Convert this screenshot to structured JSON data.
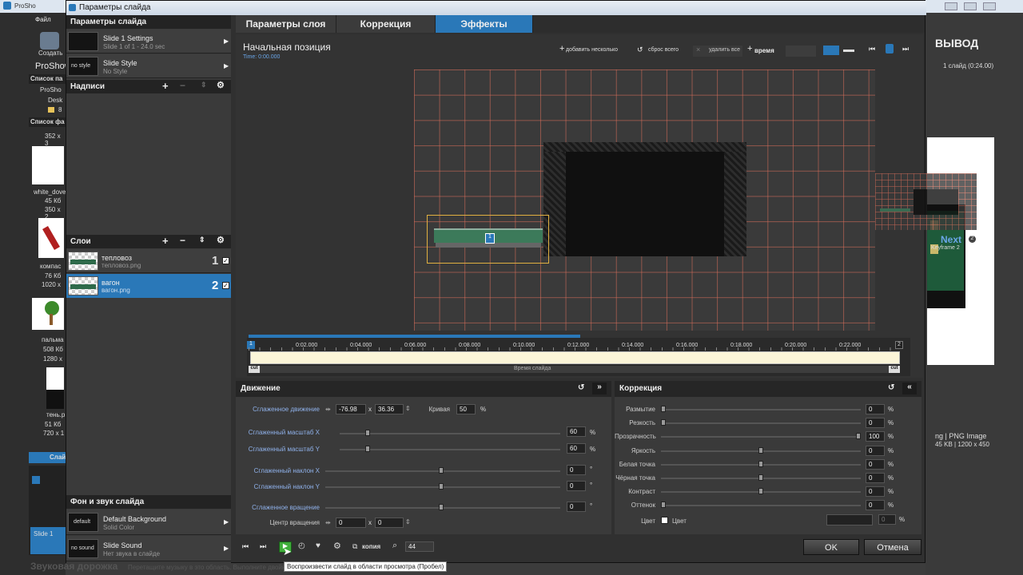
{
  "main_app": {
    "app_tab": "ProSho",
    "menu_file": "Файл",
    "create_label": "Создать",
    "proshow_label": "ProShow",
    "slides_list_header": "Список па",
    "tree_item": "ProSho",
    "tree_item2": "Desk",
    "tree_item3": "8",
    "files_list_header": "Список фа",
    "top_dim": "352 x 3",
    "files": [
      {
        "name": "white_dove",
        "size": "45 Кб",
        "dims": "350 x 2"
      },
      {
        "name": "компас",
        "size": "76 Кб",
        "dims": "1020 x"
      },
      {
        "name": "пальма",
        "size": "508 Кб",
        "dims": "1280 x"
      },
      {
        "name": "тень.р",
        "size": "51 Кб",
        "dims": "720 x 1"
      }
    ],
    "slides_tab": "Слай",
    "slide1_label": "Slide 1",
    "audio_track": "Звуковая дорожка",
    "audio_hint": "Перетащите музыку в это область. Выполните двойной",
    "output_label": "ВЫВОД",
    "output_info": "1 слайд (0:24.00)",
    "right_file_info": "ng | PNG Image",
    "right_file_info2": "45 KB | 1200 x 450"
  },
  "dialog": {
    "title": "Параметры слайда",
    "left": {
      "header": "Параметры слайда",
      "slide_settings_title": "Slide 1 Settings",
      "slide_settings_sub": "Slide 1 of 1 - 24.0 sec",
      "style_thumb": "no style",
      "style_title": "Slide Style",
      "style_sub": "No Style",
      "captions_header": "Надписи",
      "layers_header": "Слои",
      "layers": [
        {
          "name": "тепловоз",
          "file": "тепловоз.png",
          "num": "1"
        },
        {
          "name": "вагон",
          "file": "вагон.png",
          "num": "2"
        }
      ],
      "bg_header": "Фон и звук слайда",
      "bg_thumb": "default",
      "bg_title": "Default Background",
      "bg_sub": "Solid Color",
      "sound_thumb": "no sound",
      "sound_title": "Slide Sound",
      "sound_sub": "Нет звука в слайде"
    },
    "tabs": [
      "Параметры слоя",
      "Коррекция",
      "Эффекты"
    ],
    "preview": {
      "title": "Начальная позиция",
      "time": "Time: 0:00.000",
      "toolbar": {
        "add_several": "добавить несколько",
        "reset_all": "сброс всего",
        "delete_all": "удалить все",
        "time": "время"
      },
      "next_label": "Next",
      "next_num": "2",
      "keyframe_label": "Keyframe 2",
      "marker1": "1"
    },
    "timeline": {
      "ticks": [
        "0:02.000",
        "0:04.000",
        "0:06.000",
        "0:08.000",
        "0:10.000",
        "0:12.000",
        "0:14.000",
        "0:16.000",
        "0:18.000",
        "0:20.000",
        "0:22.000"
      ],
      "start_marker": "1",
      "end_marker": "2",
      "cut_left": "cut",
      "cut_right": "cut",
      "slide_time": "Время слайда"
    },
    "motion": {
      "header": "Движение",
      "rows": {
        "smooth_move": "Сглаженное движение",
        "x_val": "-76.98",
        "x_sep": "x",
        "y_val": "36.36",
        "curve_label": "Кривая",
        "curve_val": "50",
        "curve_unit": "%",
        "scale_x": "Сглаженный масштаб X",
        "scale_x_val": "60",
        "scale_y": "Сглаженный масштаб Y",
        "scale_y_val": "60",
        "tilt_x": "Сглаженный наклон X",
        "tilt_x_val": "0",
        "tilt_y": "Сглаженный наклон Y",
        "tilt_y_val": "0",
        "rotate": "Сглаженное вращение",
        "rotate_val": "0",
        "center": "Центр вращения",
        "center_x": "0",
        "center_y": "0",
        "pct": "%",
        "deg": "°"
      }
    },
    "correction": {
      "header": "Коррекция",
      "rows": [
        {
          "label": "Размытие",
          "value": "0",
          "level": 0
        },
        {
          "label": "Резкость",
          "value": "0",
          "level": 0
        },
        {
          "label": "Прозрачность",
          "value": "100",
          "level": 1
        },
        {
          "label": "Яркость",
          "value": "0",
          "level": 0.5
        },
        {
          "label": "Белая точка",
          "value": "0",
          "level": 0.5
        },
        {
          "label": "Чёрная точка",
          "value": "0",
          "level": 0.5
        },
        {
          "label": "Контраст",
          "value": "0",
          "level": 0.5
        },
        {
          "label": "Оттенок",
          "value": "0",
          "level": 0
        }
      ],
      "pct": "%",
      "color_label": "Цвет",
      "color_check": "Цвет",
      "color_val": "0"
    },
    "bottom": {
      "copy": "копия",
      "zoom": "44",
      "tooltip": "Воспроизвести слайд в области просмотра (Пробел)",
      "ok": "OK",
      "cancel": "Отмена"
    }
  }
}
